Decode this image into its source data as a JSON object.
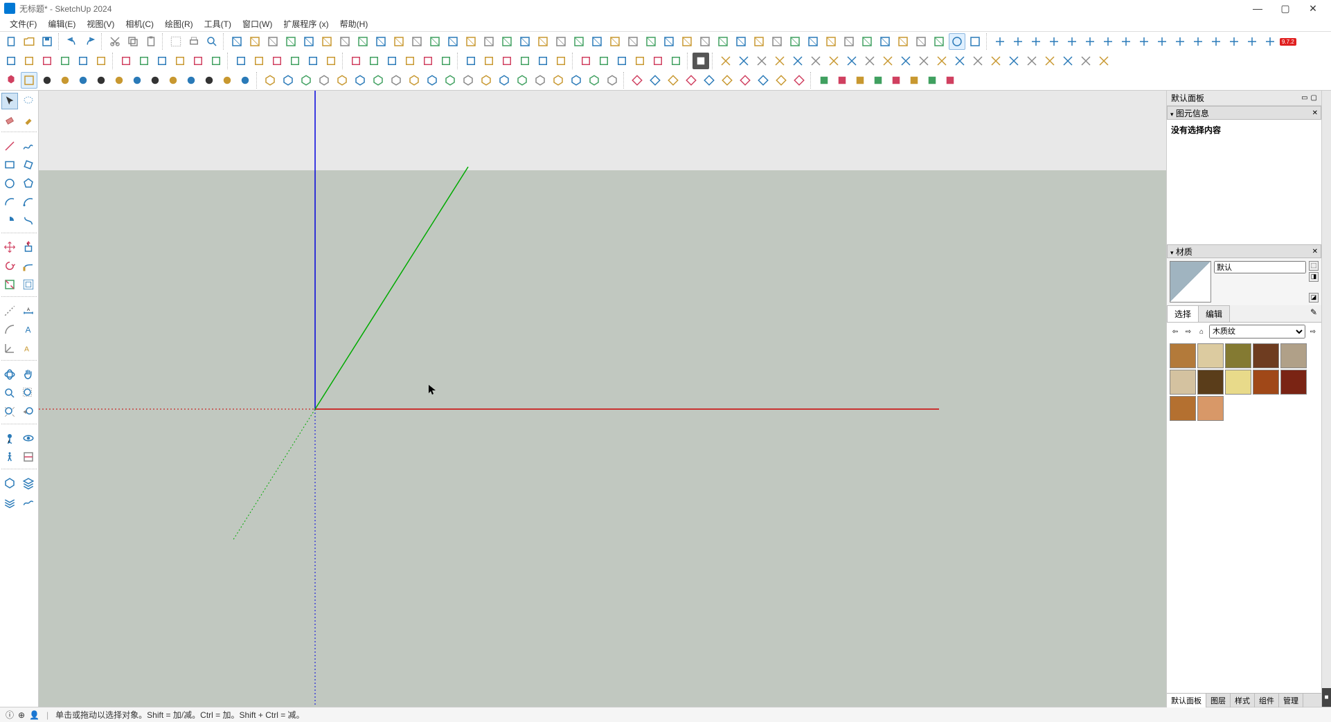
{
  "window": {
    "title": "无标题* - SketchUp 2024",
    "min": "—",
    "max": "▢",
    "close": "✕"
  },
  "menu": {
    "file": "文件(F)",
    "edit": "编辑(E)",
    "view": "视图(V)",
    "camera": "相机(C)",
    "draw": "绘图(R)",
    "tools": "工具(T)",
    "window": "窗口(W)",
    "extensions": "扩展程序 (x)",
    "help": "帮助(H)"
  },
  "badge": "9.7.2",
  "panel": {
    "title": "默认面板",
    "entity_info": "图元信息",
    "no_selection": "没有选择内容",
    "materials": "材质",
    "default_mat": "默认",
    "tab_select": "选择",
    "tab_edit": "编辑",
    "category": "木质纹",
    "bottom_tabs": {
      "default": "默认面板",
      "layers": "图层",
      "styles": "样式",
      "components": "组件",
      "manage": "管理"
    }
  },
  "material_colors": [
    "#b37a3a",
    "#dccba0",
    "#847a32",
    "#6e3c20",
    "#b0a088",
    "#d4c2a0",
    "#5a3d1a",
    "#e8da8a",
    "#a04818",
    "#7a2414",
    "#b47030",
    "#d89868"
  ],
  "status": {
    "hint": "单击或拖动以选择对象。Shift = 加/减。Ctrl = 加。Shift + Ctrl = 减。"
  }
}
